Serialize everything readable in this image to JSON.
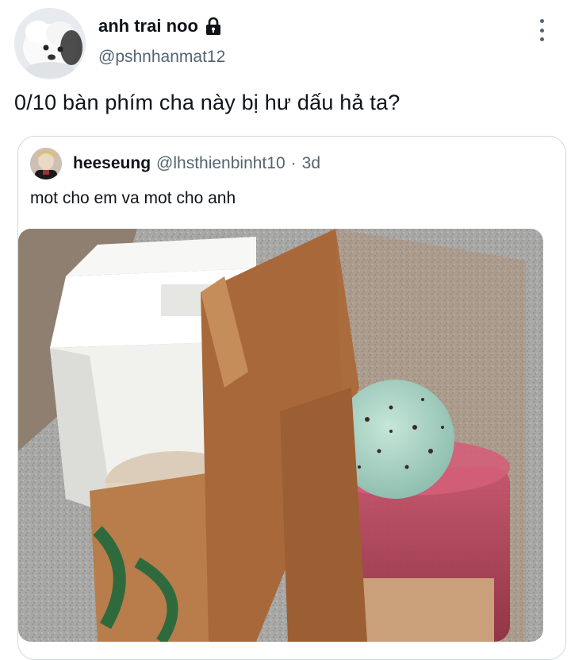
{
  "tweet": {
    "author": {
      "display_name": "anh trai noo",
      "handle": "@pshnhanmat12",
      "protected_icon": "lock-icon"
    },
    "more_icon": "more-vertical-icon",
    "text": "0/10 bàn phím cha này bị hư dấu hả ta?"
  },
  "quoted_tweet": {
    "author": {
      "display_name": "heeseung",
      "handle": "@lhsthienbinht10",
      "separator": "·",
      "time": "3d"
    },
    "text": "mot cho em va mot cho anh",
    "photo_icon": "iced-coffee-and-ice-cream-cups-photo"
  },
  "colors": {
    "text_primary": "#0f1419",
    "text_secondary": "#536471",
    "card_border": "#cfd9de"
  }
}
